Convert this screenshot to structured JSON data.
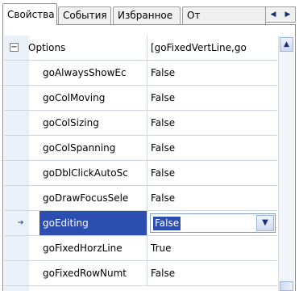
{
  "tabs": {
    "items": [
      {
        "label": "Свойства",
        "active": true
      },
      {
        "label": "События",
        "active": false
      },
      {
        "label": "Избранное",
        "active": false
      },
      {
        "label": "От",
        "active": false
      }
    ],
    "scroll_left_icon": "triangle-left-icon",
    "scroll_right_icon": "triangle-right-icon"
  },
  "inspector": {
    "category": {
      "name": "Options",
      "value": "[goFixedVertLine,go",
      "expander_icon": "minus-icon"
    },
    "rows": [
      {
        "name": "goAlwaysShowEc",
        "value": "False"
      },
      {
        "name": "goColMoving",
        "value": "False"
      },
      {
        "name": "goColSizing",
        "value": "False"
      },
      {
        "name": "goColSpanning",
        "value": "False"
      },
      {
        "name": "goDblClickAutoSc",
        "value": "False"
      },
      {
        "name": "goDrawFocusSele",
        "value": "False"
      },
      {
        "name": "goEditing",
        "value": "False"
      },
      {
        "name": "goFixedHorzLine",
        "value": "True"
      },
      {
        "name": "goFixedRowNumt",
        "value": "False"
      }
    ],
    "selected_row_icon": "arrow-right-icon",
    "dropdown_icon": "chevron-down-icon"
  },
  "colors": {
    "selection": "#2b4fb0",
    "gutter": "#eaf0f8"
  }
}
